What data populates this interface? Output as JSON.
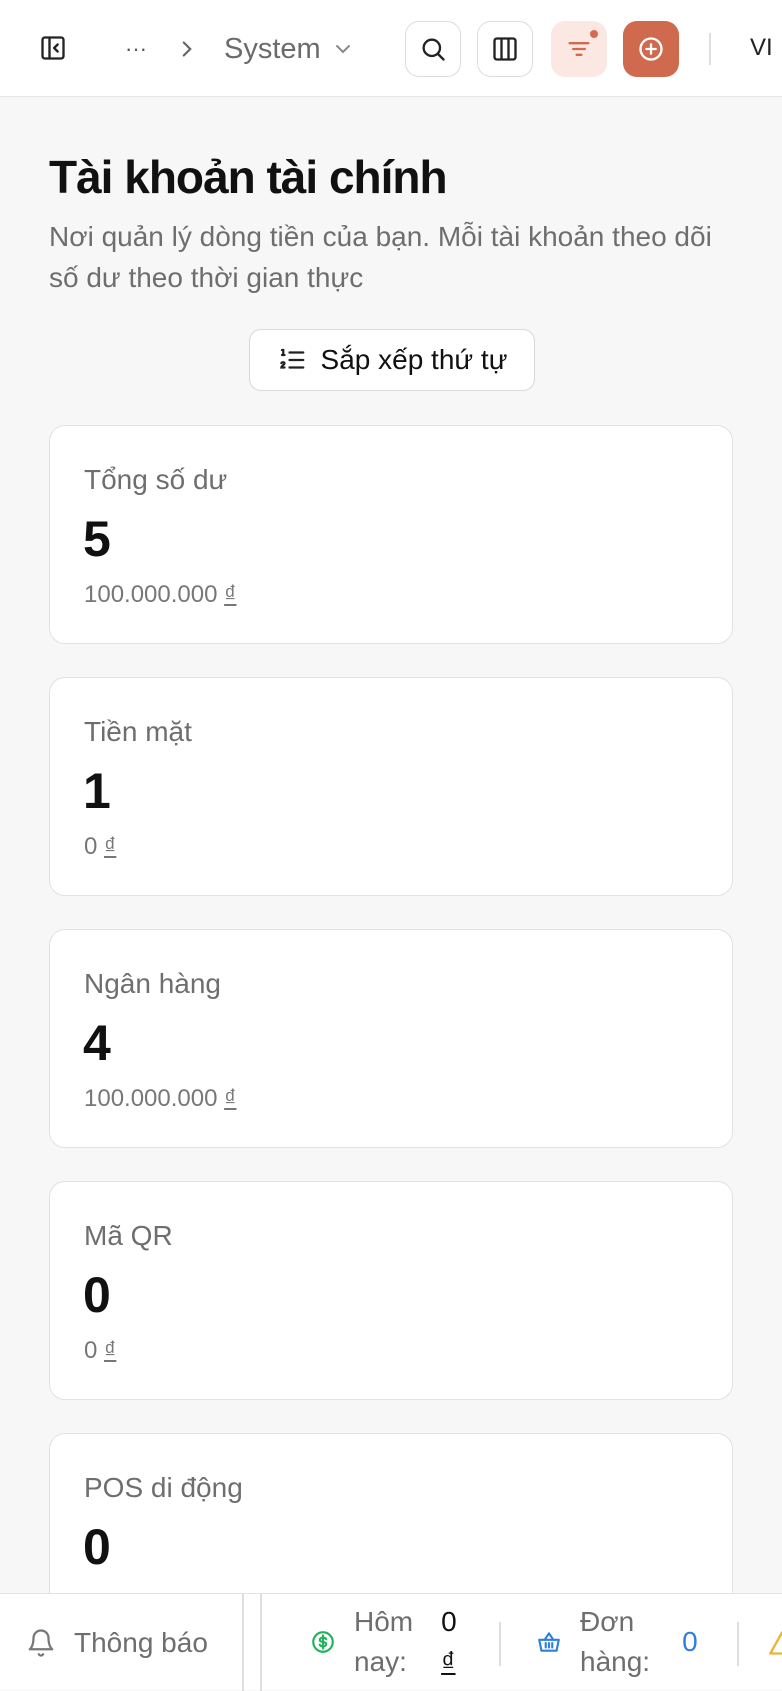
{
  "topbar": {
    "breadcrumb_ellipsis": "···",
    "breadcrumb_current": "System",
    "language": "VI"
  },
  "page": {
    "title": "Tài khoản tài chính",
    "subtitle": "Nơi quản lý dòng tiền của bạn. Mỗi tài khoản theo dõi số dư theo thời gian thực",
    "sort_label": "Sắp xếp thứ tự"
  },
  "cards": [
    {
      "label": "Tổng số dư",
      "count": "5",
      "amount": "100.000.000",
      "currency": "₫"
    },
    {
      "label": "Tiền mặt",
      "count": "1",
      "amount": "0",
      "currency": "₫"
    },
    {
      "label": "Ngân hàng",
      "count": "4",
      "amount": "100.000.000",
      "currency": "₫"
    },
    {
      "label": "Mã QR",
      "count": "0",
      "amount": "0",
      "currency": "₫"
    },
    {
      "label": "POS di động",
      "count": "0",
      "amount": "",
      "currency": ""
    }
  ],
  "bottombar": {
    "notifications": "Thông báo",
    "today_label_1": "Hôm",
    "today_label_2": "nay:",
    "today_value": "0",
    "today_currency": "₫",
    "orders_label_1": "Đơn",
    "orders_label_2": "hàng:",
    "orders_value": "0"
  },
  "colors": {
    "accent": "#cf6a4f",
    "accent_soft": "#fbe8e3",
    "money_green": "#22b35e",
    "orders_blue": "#2f7fe0",
    "warning": "#e8b43a"
  }
}
